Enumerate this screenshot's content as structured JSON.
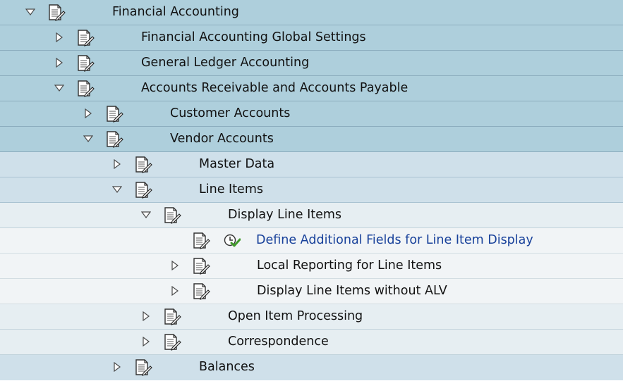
{
  "tree": {
    "nodes": [
      {
        "label": "Financial Accounting",
        "level": 0,
        "toggle": "expanded"
      },
      {
        "label": "Financial Accounting Global Settings",
        "level": 1,
        "toggle": "collapsed"
      },
      {
        "label": "General Ledger Accounting",
        "level": 1,
        "toggle": "collapsed"
      },
      {
        "label": "Accounts Receivable and Accounts Payable",
        "level": 1,
        "toggle": "expanded"
      },
      {
        "label": "Customer Accounts",
        "level": 2,
        "toggle": "collapsed"
      },
      {
        "label": "Vendor Accounts",
        "level": 2,
        "toggle": "expanded"
      },
      {
        "label": "Master Data",
        "level": 3,
        "toggle": "collapsed"
      },
      {
        "label": "Line Items",
        "level": 3,
        "toggle": "expanded"
      },
      {
        "label": "Display Line Items",
        "level": 4,
        "toggle": "expanded"
      },
      {
        "label": "Define Additional Fields for Line Item Display",
        "level": 5,
        "toggle": "none",
        "executable": true
      },
      {
        "label": "Local Reporting for Line Items",
        "level": 5,
        "toggle": "collapsed"
      },
      {
        "label": "Display Line Items without ALV",
        "level": 5,
        "toggle": "collapsed"
      },
      {
        "label": "Open Item Processing",
        "level": 4,
        "toggle": "collapsed"
      },
      {
        "label": "Correspondence",
        "level": 4,
        "toggle": "collapsed"
      },
      {
        "label": "Balances",
        "level": 3,
        "toggle": "collapsed"
      }
    ]
  },
  "icons": {
    "expanded": "triangle-down-icon",
    "collapsed": "triangle-right-icon",
    "document": "img-document-icon",
    "execute": "clock-execute-icon"
  },
  "colors": {
    "link_text": "#17409a",
    "row_levels_0_2": "#aecfdc",
    "row_level_3": "#cfe0ea",
    "row_level_4": "#e6eef2",
    "row_level_5": "#f1f4f6"
  }
}
